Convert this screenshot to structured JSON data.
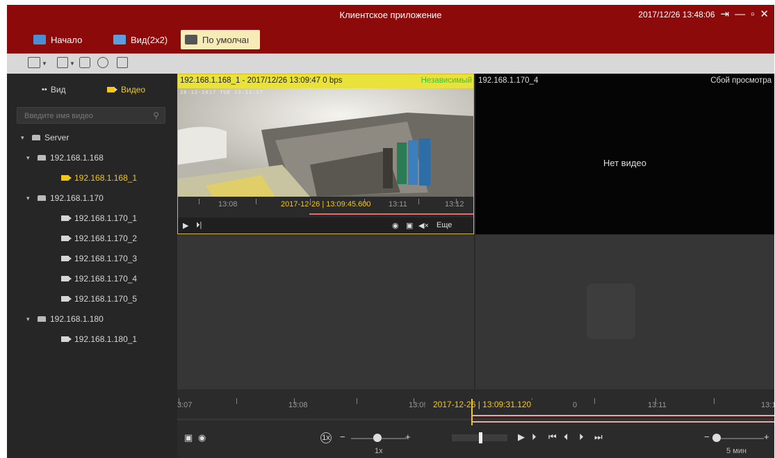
{
  "titlebar": {
    "app_title": "Клиентское приложение",
    "datetime": "2017/12/26 13:48:06",
    "logout_glyph": "⇥",
    "minimize_glyph": "—",
    "maximize_glyph": "▫",
    "close_glyph": "✕"
  },
  "tabs": [
    {
      "label": "Начало",
      "icon": "monitor-icon",
      "color": "#4a8fd6"
    },
    {
      "label": "Вид(2x2)",
      "icon": "grid-view-icon",
      "color": "#5aa0e0"
    },
    {
      "label": "По умолчаı",
      "icon": "clapper-icon",
      "color": "#555555"
    }
  ],
  "sidebar": {
    "tab_view": "Вид",
    "tab_video": "Видео",
    "search_placeholder": "Введите имя видео",
    "tree": [
      {
        "label": "Server",
        "level": 0,
        "type": "server",
        "expanded": true
      },
      {
        "label": "192.168.1.168",
        "level": 1,
        "type": "device",
        "expanded": true
      },
      {
        "label": "192.168.1.168_1",
        "level": 2,
        "type": "camera",
        "selected": true
      },
      {
        "label": "192.168.1.170",
        "level": 1,
        "type": "device",
        "expanded": true
      },
      {
        "label": "192.168.1.170_1",
        "level": 2,
        "type": "camera"
      },
      {
        "label": "192.168.1.170_2",
        "level": 2,
        "type": "camera"
      },
      {
        "label": "192.168.1.170_3",
        "level": 2,
        "type": "camera"
      },
      {
        "label": "192.168.1.170_4",
        "level": 2,
        "type": "camera"
      },
      {
        "label": "192.168.1.170_5",
        "level": 2,
        "type": "camera"
      },
      {
        "label": "192.168.1.180",
        "level": 1,
        "type": "device",
        "expanded": true
      },
      {
        "label": "192.168.1.180_1",
        "level": 2,
        "type": "camera"
      }
    ]
  },
  "pane1": {
    "header": "192.168.1.168_1 - 2017/12/26 13:09:47 0 bps",
    "mode": "Независимый",
    "osd": "26-12-2017 TUE 13:12:17",
    "timeline": {
      "labels": [
        "13:08",
        "13:11",
        "13:12"
      ],
      "current": "2017-12-26 | 13:09:45.600"
    },
    "more_label": "Еще"
  },
  "pane2": {
    "title": "192.168.1.170_4",
    "status": "Сбой просмотра",
    "message": "Нет видео"
  },
  "bottom": {
    "timeline_labels": [
      "3:07",
      "13:08",
      "13:0!",
      "0",
      "13:11",
      "13:1"
    ],
    "current": "2017-12-26 | 13:09:31.120",
    "speed_badge": "1x",
    "speed_label": "1x",
    "range_label": "5 мин",
    "minus": "−",
    "plus": "+"
  },
  "colors": {
    "brand_red": "#8d0a0a",
    "accent_yellow": "#f0c81e",
    "mode_green": "#39c43a",
    "cursor_red": "#e8a8a8"
  }
}
